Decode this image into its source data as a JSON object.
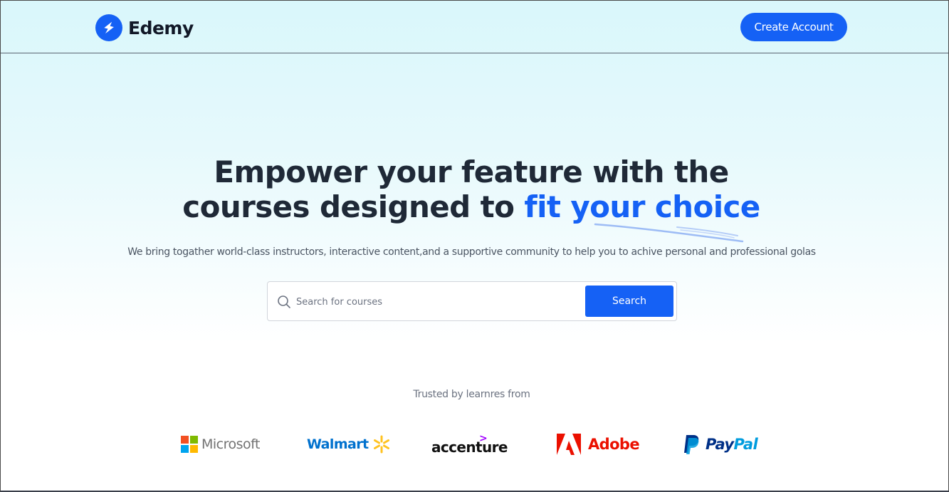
{
  "navbar": {
    "logo_text": "Edemy",
    "create_account_label": "Create Account"
  },
  "hero": {
    "title_line1": "Empower your feature with the",
    "title_line2_prefix": "courses designed to ",
    "title_line2_accent": "fit your choice",
    "subtitle": "We bring togather world-class instructors, interactive content,and a supportive community to help you to achive personal and professional golas"
  },
  "search": {
    "placeholder": "Search for courses",
    "value": "",
    "button_label": "Search"
  },
  "trusted": {
    "label": "Trusted by learnres from",
    "brands": [
      {
        "name": "Microsoft",
        "icon": "microsoft-logo"
      },
      {
        "name": "Walmart",
        "icon": "walmart-logo"
      },
      {
        "name": "accenture",
        "icon": "accenture-logo"
      },
      {
        "name": "Adobe",
        "icon": "adobe-logo"
      },
      {
        "name": "PayPal",
        "name_part1": "Pay",
        "name_part2": "Pal",
        "icon": "paypal-logo"
      }
    ]
  },
  "colors": {
    "accent": "#1561f5",
    "heading": "#1f2937",
    "hero_bg_top": "#d9f7fb"
  }
}
